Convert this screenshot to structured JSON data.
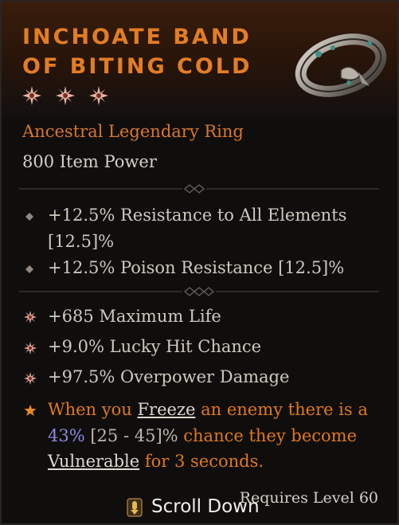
{
  "item": {
    "title_line1": "Inchoate Band",
    "title_line2": "of Biting Cold",
    "type": "Ancestral Legendary Ring",
    "item_power": "800 Item Power",
    "stars": 3
  },
  "implicits": [
    {
      "line1": "+12.5% Resistance to All Elements",
      "line2": "[12.5]%"
    },
    {
      "line1": "+12.5% Poison Resistance [12.5]%"
    }
  ],
  "affixes": [
    {
      "text": "+685 Maximum Life"
    },
    {
      "text": "+9.0% Lucky Hit Chance"
    },
    {
      "text": "+97.5% Overpower Damage"
    }
  ],
  "legendary": {
    "t1": "When you ",
    "freeze": "Freeze",
    "t2": " an enemy there is a",
    "value": "43%",
    "range": " [25 - 45]%",
    "t3": " chance they become",
    "vulnerable": "Vulnerable",
    "t4": " for 3 seconds."
  },
  "requires": "Requires Level 60",
  "scroll_label": "Scroll Down",
  "colors": {
    "title": "#e37d24",
    "legendary": "#e0781e",
    "value_highlight": "#8b8ae0"
  },
  "icons": {
    "star": "legendary-star-icon",
    "implicit_bullet": "diamond-bullet-icon",
    "affix_bullet": "starburst-bullet-icon",
    "legendary_bullet": "orange-star-icon",
    "scroll": "scroll-key-icon"
  }
}
